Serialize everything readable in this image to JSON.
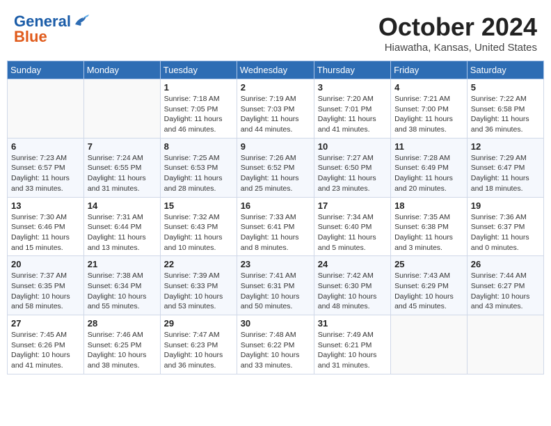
{
  "header": {
    "logo_line1": "General",
    "logo_line2": "Blue",
    "month_title": "October 2024",
    "location": "Hiawatha, Kansas, United States"
  },
  "days_of_week": [
    "Sunday",
    "Monday",
    "Tuesday",
    "Wednesday",
    "Thursday",
    "Friday",
    "Saturday"
  ],
  "weeks": [
    [
      {
        "num": "",
        "info": ""
      },
      {
        "num": "",
        "info": ""
      },
      {
        "num": "1",
        "info": "Sunrise: 7:18 AM\nSunset: 7:05 PM\nDaylight: 11 hours and 46 minutes."
      },
      {
        "num": "2",
        "info": "Sunrise: 7:19 AM\nSunset: 7:03 PM\nDaylight: 11 hours and 44 minutes."
      },
      {
        "num": "3",
        "info": "Sunrise: 7:20 AM\nSunset: 7:01 PM\nDaylight: 11 hours and 41 minutes."
      },
      {
        "num": "4",
        "info": "Sunrise: 7:21 AM\nSunset: 7:00 PM\nDaylight: 11 hours and 38 minutes."
      },
      {
        "num": "5",
        "info": "Sunrise: 7:22 AM\nSunset: 6:58 PM\nDaylight: 11 hours and 36 minutes."
      }
    ],
    [
      {
        "num": "6",
        "info": "Sunrise: 7:23 AM\nSunset: 6:57 PM\nDaylight: 11 hours and 33 minutes."
      },
      {
        "num": "7",
        "info": "Sunrise: 7:24 AM\nSunset: 6:55 PM\nDaylight: 11 hours and 31 minutes."
      },
      {
        "num": "8",
        "info": "Sunrise: 7:25 AM\nSunset: 6:53 PM\nDaylight: 11 hours and 28 minutes."
      },
      {
        "num": "9",
        "info": "Sunrise: 7:26 AM\nSunset: 6:52 PM\nDaylight: 11 hours and 25 minutes."
      },
      {
        "num": "10",
        "info": "Sunrise: 7:27 AM\nSunset: 6:50 PM\nDaylight: 11 hours and 23 minutes."
      },
      {
        "num": "11",
        "info": "Sunrise: 7:28 AM\nSunset: 6:49 PM\nDaylight: 11 hours and 20 minutes."
      },
      {
        "num": "12",
        "info": "Sunrise: 7:29 AM\nSunset: 6:47 PM\nDaylight: 11 hours and 18 minutes."
      }
    ],
    [
      {
        "num": "13",
        "info": "Sunrise: 7:30 AM\nSunset: 6:46 PM\nDaylight: 11 hours and 15 minutes."
      },
      {
        "num": "14",
        "info": "Sunrise: 7:31 AM\nSunset: 6:44 PM\nDaylight: 11 hours and 13 minutes."
      },
      {
        "num": "15",
        "info": "Sunrise: 7:32 AM\nSunset: 6:43 PM\nDaylight: 11 hours and 10 minutes."
      },
      {
        "num": "16",
        "info": "Sunrise: 7:33 AM\nSunset: 6:41 PM\nDaylight: 11 hours and 8 minutes."
      },
      {
        "num": "17",
        "info": "Sunrise: 7:34 AM\nSunset: 6:40 PM\nDaylight: 11 hours and 5 minutes."
      },
      {
        "num": "18",
        "info": "Sunrise: 7:35 AM\nSunset: 6:38 PM\nDaylight: 11 hours and 3 minutes."
      },
      {
        "num": "19",
        "info": "Sunrise: 7:36 AM\nSunset: 6:37 PM\nDaylight: 11 hours and 0 minutes."
      }
    ],
    [
      {
        "num": "20",
        "info": "Sunrise: 7:37 AM\nSunset: 6:35 PM\nDaylight: 10 hours and 58 minutes."
      },
      {
        "num": "21",
        "info": "Sunrise: 7:38 AM\nSunset: 6:34 PM\nDaylight: 10 hours and 55 minutes."
      },
      {
        "num": "22",
        "info": "Sunrise: 7:39 AM\nSunset: 6:33 PM\nDaylight: 10 hours and 53 minutes."
      },
      {
        "num": "23",
        "info": "Sunrise: 7:41 AM\nSunset: 6:31 PM\nDaylight: 10 hours and 50 minutes."
      },
      {
        "num": "24",
        "info": "Sunrise: 7:42 AM\nSunset: 6:30 PM\nDaylight: 10 hours and 48 minutes."
      },
      {
        "num": "25",
        "info": "Sunrise: 7:43 AM\nSunset: 6:29 PM\nDaylight: 10 hours and 45 minutes."
      },
      {
        "num": "26",
        "info": "Sunrise: 7:44 AM\nSunset: 6:27 PM\nDaylight: 10 hours and 43 minutes."
      }
    ],
    [
      {
        "num": "27",
        "info": "Sunrise: 7:45 AM\nSunset: 6:26 PM\nDaylight: 10 hours and 41 minutes."
      },
      {
        "num": "28",
        "info": "Sunrise: 7:46 AM\nSunset: 6:25 PM\nDaylight: 10 hours and 38 minutes."
      },
      {
        "num": "29",
        "info": "Sunrise: 7:47 AM\nSunset: 6:23 PM\nDaylight: 10 hours and 36 minutes."
      },
      {
        "num": "30",
        "info": "Sunrise: 7:48 AM\nSunset: 6:22 PM\nDaylight: 10 hours and 33 minutes."
      },
      {
        "num": "31",
        "info": "Sunrise: 7:49 AM\nSunset: 6:21 PM\nDaylight: 10 hours and 31 minutes."
      },
      {
        "num": "",
        "info": ""
      },
      {
        "num": "",
        "info": ""
      }
    ]
  ]
}
